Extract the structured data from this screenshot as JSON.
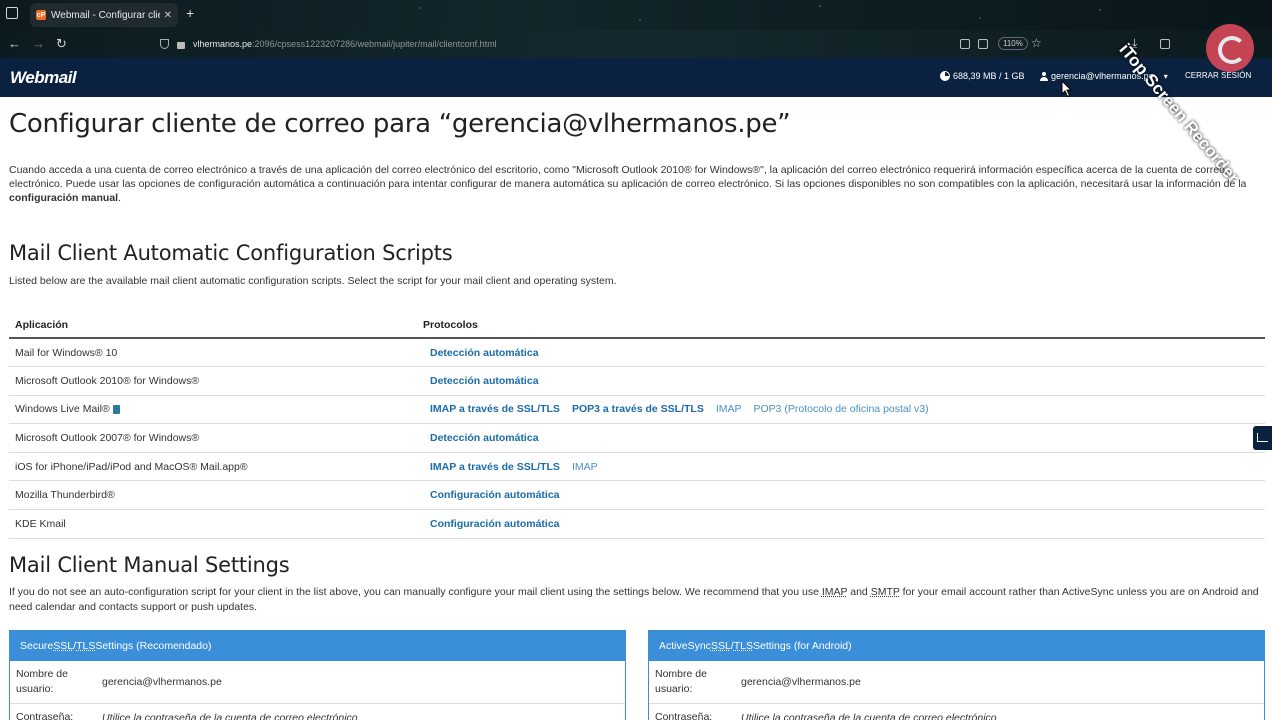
{
  "browser": {
    "tab_title": "Webmail - Configurar cliente d",
    "tab_favicon": "cP",
    "url_host": "vlhermanos.pe",
    "url_rest": ":2096/cpsess1223207286/webmail/jupiter/mail/clientconf.html",
    "zoom": "110%"
  },
  "header": {
    "logo": "Webmail",
    "quota": "688,39 MB / 1 GB",
    "user": "gerencia@vlhermanos.pe",
    "logout": "CERRAR SESIÓN"
  },
  "watermark": "iTop Screen Recorder",
  "page": {
    "title": "Configurar cliente de correo para “gerencia@vlhermanos.pe”",
    "intro": "Cuando acceda a una cuenta de correo electrónico a través de una aplicación del correo electrónico del escritorio, como \"Microsoft Outlook 2010® for Windows®\", la aplicación del correo electrónico requerirá información específica acerca de la cuenta de correo electrónico. Puede usar las opciones de configuración automática a continuación para intentar configurar de manera automática su aplicación de correo electrónico. Si las opciones disponibles no son compatibles con la aplicación, necesitará usar la información de la ",
    "intro_bold": "configuración manual",
    "intro_end": "."
  },
  "auto": {
    "heading": "Mail Client Automatic Configuration Scripts",
    "description": "Listed below are the available mail client automatic configuration scripts. Select the script for your mail client and operating system.",
    "col_app": "Aplicación",
    "col_proto": "Protocolos",
    "rows": [
      {
        "app": "Mail for Windows® 10",
        "links": [
          {
            "t": "Detección automática",
            "s": "strong"
          }
        ]
      },
      {
        "app": "Microsoft Outlook 2010® for Windows®",
        "links": [
          {
            "t": "Detección automática",
            "s": "strong"
          }
        ]
      },
      {
        "app": "Windows Live Mail®",
        "icon": true,
        "links": [
          {
            "t": "IMAP a través de SSL/TLS",
            "s": "strong"
          },
          {
            "t": "POP3 a través de SSL/TLS",
            "s": "strong"
          },
          {
            "t": "IMAP",
            "s": "light"
          },
          {
            "t": "POP3 (Protocolo de oficina postal v3)",
            "s": "light"
          }
        ]
      },
      {
        "app": "Microsoft Outlook 2007® for Windows®",
        "links": [
          {
            "t": "Detección automática",
            "s": "strong"
          }
        ]
      },
      {
        "app": "iOS for iPhone/iPad/iPod and MacOS® Mail.app®",
        "links": [
          {
            "t": "IMAP a través de SSL/TLS",
            "s": "strong"
          },
          {
            "t": "IMAP",
            "s": "light"
          }
        ]
      },
      {
        "app": "Mozilla Thunderbird®",
        "links": [
          {
            "t": "Configuración automática",
            "s": "strong"
          }
        ]
      },
      {
        "app": "KDE Kmail",
        "links": [
          {
            "t": "Configuración automática",
            "s": "strong"
          }
        ]
      }
    ]
  },
  "manual": {
    "heading": "Mail Client Manual Settings",
    "desc_a": "If you do not see an auto-configuration script for your client in the list above, you can manually configure your mail client using the settings below. We recommend that you use ",
    "imap": "IMAP",
    "and": " and ",
    "smtp": "SMTP",
    "desc_b": " for your email account rather than ActiveSync unless you are on Android and need calendar and contacts support or push updates."
  },
  "panels": [
    {
      "title_a": "Secure ",
      "ssl": "SSL",
      "slash": "/",
      "tls": "TLS",
      "title_b": " Settings (Recomendado)",
      "user_label": "Nombre de usuario:",
      "user_value": "gerencia@vlhermanos.pe",
      "pass_label": "Contraseña:",
      "pass_value": "Utilice la contraseña de la cuenta de correo electrónico."
    },
    {
      "title_a": "ActiveSync ",
      "ssl": "SSL",
      "slash": "/",
      "tls": "TLS",
      "title_b": " Settings (for Android)",
      "user_label": "Nombre de usuario:",
      "user_value": "gerencia@vlhermanos.pe",
      "pass_label": "Contraseña:",
      "pass_value": "Utilice la contraseña de la cuenta de correo electrónico."
    }
  ]
}
